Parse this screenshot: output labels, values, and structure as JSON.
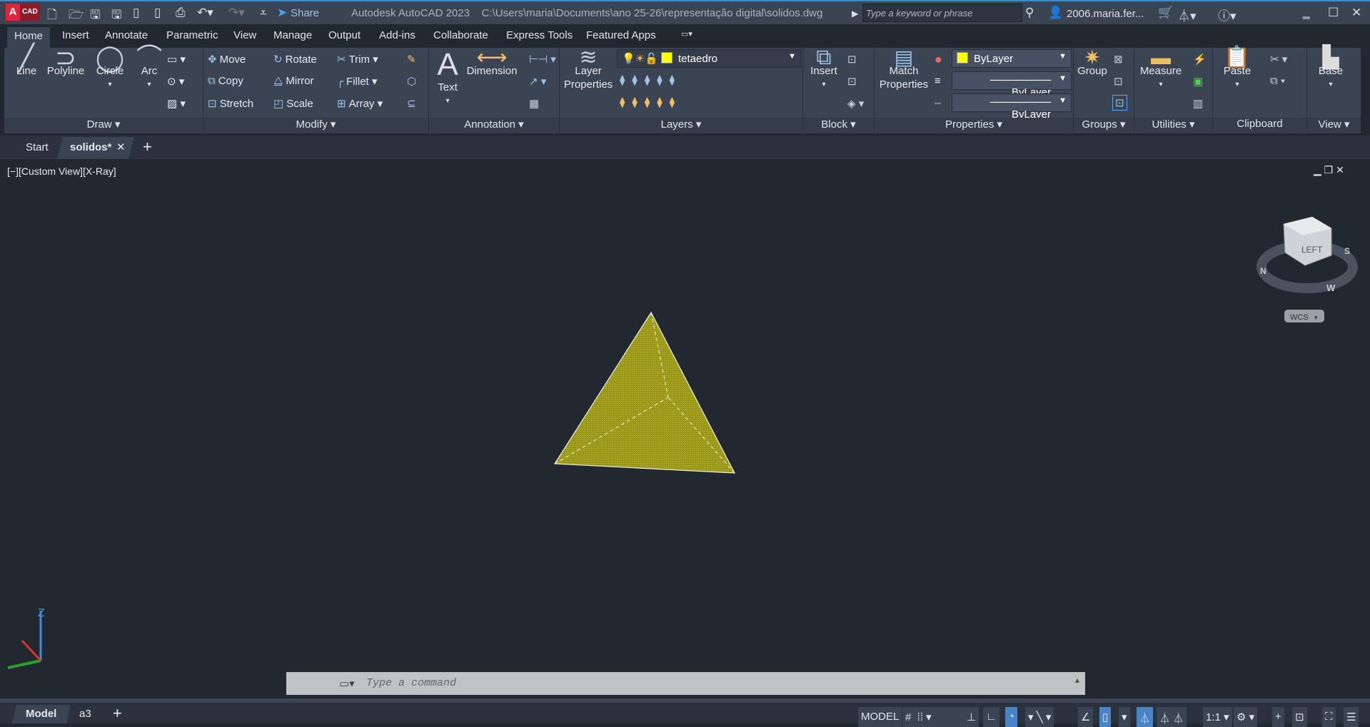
{
  "app": {
    "logo": "A",
    "logo_sub": "CAD",
    "title": "Autodesk AutoCAD 2023",
    "file_path": "C:\\Users\\maria\\Documents\\ano 25-26\\representação digital\\solidos.dwg",
    "share": "Share",
    "search_placeholder": "Type a keyword or phrase",
    "user": "2006.maria.fer..."
  },
  "ribbon_tabs": [
    "Home",
    "Insert",
    "Annotate",
    "Parametric",
    "View",
    "Manage",
    "Output",
    "Add-ins",
    "Collaborate",
    "Express Tools",
    "Featured Apps"
  ],
  "draw": {
    "label": "Draw",
    "line": "Line",
    "polyline": "Polyline",
    "circle": "Circle",
    "arc": "Arc"
  },
  "modify": {
    "label": "Modify",
    "move": "Move",
    "rotate": "Rotate",
    "trim": "Trim",
    "copy": "Copy",
    "mirror": "Mirror",
    "fillet": "Fillet",
    "stretch": "Stretch",
    "scale": "Scale",
    "array": "Array"
  },
  "annotation": {
    "label": "Annotation",
    "text": "Text",
    "dimension": "Dimension"
  },
  "layers": {
    "label": "Layers",
    "layer_properties_1": "Layer",
    "layer_properties_2": "Properties",
    "current_layer": "tetaedro"
  },
  "block": {
    "label": "Block",
    "insert": "Insert"
  },
  "properties": {
    "label": "Properties",
    "match_1": "Match",
    "match_2": "Properties",
    "color": "ByLayer",
    "linetype": "ByLayer",
    "lineweight": "ByLayer"
  },
  "groups": {
    "label": "Groups",
    "group": "Group"
  },
  "utilities": {
    "label": "Utilities",
    "measure": "Measure"
  },
  "clipboard": {
    "label": "Clipboard",
    "paste": "Paste"
  },
  "view": {
    "label": "View",
    "base": "Base"
  },
  "doc_tabs": {
    "start": "Start",
    "active": "solidos*"
  },
  "viewport": {
    "label": "[−][Custom View][X-Ray]",
    "viewcube_face": "LEFT",
    "wcs": "WCS",
    "compass": [
      "N",
      "S",
      "W"
    ],
    "ucs_z": "Z"
  },
  "command": {
    "placeholder": "Type a command"
  },
  "layout_tabs": [
    "Model",
    "a3"
  ],
  "status": {
    "model": "MODEL",
    "scale": "1:1"
  },
  "colors": {
    "accent": "#2f8fd6",
    "solid": "#a8a31a",
    "layer_color": "#ffff00"
  }
}
